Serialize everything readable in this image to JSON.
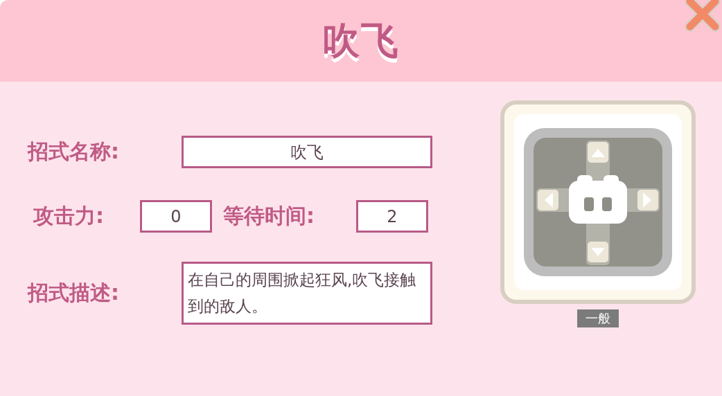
{
  "header": {
    "title": "吹飞"
  },
  "fields": [
    {
      "label": "招式名称:",
      "value": "吹飞"
    },
    {
      "label": "攻击力:",
      "value": "0"
    },
    {
      "label": "等待时间:",
      "value": "2"
    },
    {
      "label": "招式描述:",
      "value": "在自己的周围掀起狂风,吹飞接触到的敌人。"
    }
  ],
  "skill_icon": {
    "badge": "一般"
  }
}
